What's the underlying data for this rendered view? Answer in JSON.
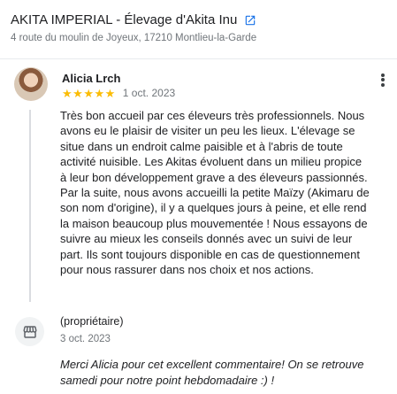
{
  "business": {
    "title": "AKITA IMPERIAL - Élevage d'Akita Inu",
    "address": "4 route du moulin de Joyeux, 17210 Montlieu-la-Garde",
    "link_icon": "open-in-new-icon"
  },
  "review": {
    "reviewer_name": "Alicia Lrch",
    "rating": 5,
    "stars": [
      "★",
      "★",
      "★",
      "★",
      "★"
    ],
    "date": "1 oct. 2023",
    "menu_icon": "more-vert-icon",
    "text": "Très bon accueil par ces éleveurs très professionnels. Nous avons eu le plaisir de visiter un peu les lieux. L'élevage se situe dans un endroit calme paisible et à l'abris de toute activité nuisible. Les Akitas évoluent dans un milieu propice à leur bon développement grave a des éleveurs passionnés. Par la suite, nous avons accueilli la petite Maïzy (Akimaru de son nom d'origine), il y a quelques jours à peine, et elle rend la maison beaucoup plus mouvementée ! Nous essayons de suivre au mieux les conseils donnés avec un suivi de leur part. Ils sont toujours disponible en cas de questionnement pour nous rassurer dans nos choix et nos actions."
  },
  "owner_response": {
    "label": "(propriétaire)",
    "date": "3 oct. 2023",
    "icon": "storefront-icon",
    "text": "Merci Alicia pour cet excellent commentaire! On se retrouve samedi pour notre point hebdomadaire :) !"
  },
  "colors": {
    "star": "#fbbc04",
    "link_icon": "#1a73e8",
    "secondary_text": "#70757a"
  }
}
